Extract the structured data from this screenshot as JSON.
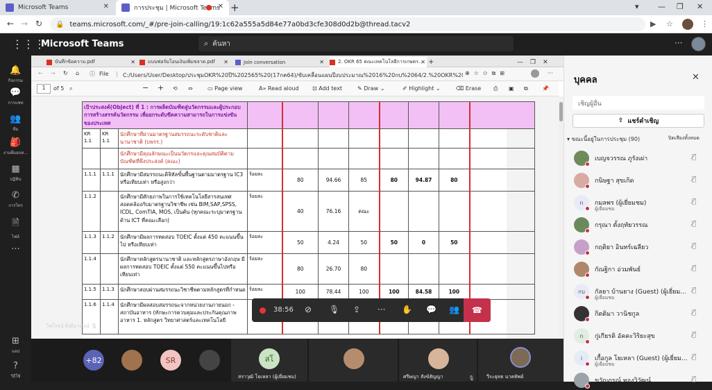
{
  "browser": {
    "tabs": [
      {
        "title": "Microsoft Teams",
        "active": false
      },
      {
        "title": "การประชุม | Microsoft Teams",
        "active": true
      }
    ],
    "url": "teams.microsoft.com/_#/pre-join-calling/19:1c62a555a5d84e77a0bd3cfe308d0d2b@thread.tacv2"
  },
  "teams": {
    "app_name": "Microsoft Teams",
    "search_placeholder": "ค้นหา",
    "rail": [
      "กิจกรรม",
      "การแชท",
      "ทีม",
      "งานที่มอบห...",
      "ปฏิทิน",
      "การโทร",
      "ไฟล์",
      "",
      "แอป",
      "วิธีใช้"
    ]
  },
  "shared": {
    "edge_tabs": [
      "บันทึกข้อความ.pdf",
      "แบบฟอร์มโอนเงินเพิ่มขจาด.pdf",
      "Join conversation",
      "2. OKR 65 คณะเทคโนโลยีการเกษตร..."
    ],
    "file_label": "File",
    "file_path": "C:/Users/User/Desktop/ประชุมOKR%20ปี%202565%20(17กค64)/ขับเคลื่อนแผนปีงบประมาณ%2016%20กบ%2064/2.%20OKR%2065%20คณะเทคโ...",
    "pdf": {
      "page": "1",
      "of_pages": "of 5",
      "page_view": "Page view",
      "read_aloud": "Read aloud",
      "add_text": "Add text",
      "draw": "Draw",
      "highlight": "Highlight",
      "erase": "Erase"
    },
    "table": {
      "objective": "เป้าประสงค์(Object) ที่ 1 : การผลิตบัณฑิตสู่นวัตกรรมและผู้ประกอบการสร้างสรรค์นวัตกรรม เพื่อยกระดับขีดความสามารถในการแข่งขันของประเทศ",
      "rows": [
        {
          "c1": "KR 1.1",
          "c2": "KR 1.1",
          "text": "นักศึกษาที่ผ่านมาตรฐานสมรรถนะระดับชาติและนานาชาติ (บพรร.)",
          "unit": "",
          "v": [
            "",
            "",
            "",
            "",
            "",
            ""
          ],
          "red": true
        },
        {
          "c1": "",
          "c2": "",
          "text": "นักศึกษามีคุณลักษณะเป็นนวัตกรและคุณสมบัติตามบัณฑิตที่พึงประสงค์ (คณะ)",
          "unit": "",
          "v": [
            "",
            "",
            "",
            "",
            "",
            ""
          ],
          "red": true
        },
        {
          "c1": "1.1.1",
          "c2": "1.1.1",
          "text": "นักศึกษามีสมรรถนะดิจิทัลขั้นพื้นฐานตามมาตรฐาน IC3 หรือเทียบเท่า หรือสูงกว่า",
          "unit": "ร้อยละ",
          "v": [
            "80",
            "94.66",
            "85",
            "80",
            "94.87",
            "80"
          ]
        },
        {
          "c1": "1.1.2",
          "c2": "",
          "text": "นักศึกษามีศักยภาพในการใช้เทคโนโลยีสารสนเทศสอดคล้องกับมาตรฐานวิชาชีพ เช่น BIM,SAP,SPSS, ICDL, ComTIA, MOS, เป็นต้น (ทุกคณะระบุมาตรฐานด้าน ICT ที่คณะเลือก)",
          "unit": "ร้อยละ",
          "v": [
            "40",
            "76.16",
            "คณะ",
            "",
            "",
            ""
          ]
        },
        {
          "c1": "1.1.3",
          "c2": "1.1.2",
          "text": "นักศึกษามีผลการทดสอบ TOEIC ตั้งแต่ 450 คะแนนขึ้นไป หรือเทียบเท่า",
          "unit": "ร้อยละ",
          "v": [
            "50",
            "4.24",
            "50",
            "50",
            "0",
            "50"
          ]
        },
        {
          "c1": "1.1.4",
          "c2": "",
          "text": "นักศึกษาหลักสูตรนานาชาติ และหลักสูตรภาษาอังกฤษ มีผลการทดสอบ TOEIC ตั้งแต่ 550 คะแนนขึ้นไปหรือเทียบเท่า",
          "unit": "ร้อยละ",
          "v": [
            "80",
            "26.70",
            "80",
            "",
            "",
            ""
          ]
        },
        {
          "c1": "1.1.5",
          "c2": "1.1.3",
          "text": "นักศึกษาสอบผ่านสมรรถนะวิชาชีพตามหลักสูตรที่กำหนด",
          "unit": "ร้อยละ",
          "v": [
            "100",
            "78.44",
            "100",
            "100",
            "84.58",
            "100"
          ]
        },
        {
          "c1": "1.1.6",
          "c2": "1.1.4",
          "text": "นักศึกษามีผลสอบสมรรถนะจากหน่วยงานภายนอก - สถาบันอาหาร (ทักษะการควบคุมและประกันคุณภาพอาหาร 1. หลักสูตร วิทยาศาสตร์และเทคโนโลยี",
          "unit": "",
          "v": [
            "",
            "",
            "",
            "",
            "",
            ""
          ]
        }
      ]
    }
  },
  "meeting": {
    "timer": "38:56",
    "presenter": "ไพโรจน์ ยิ่งมีอารมณ์"
  },
  "gallery": {
    "overflow": "+82",
    "tiles": [
      {
        "initials": "SR",
        "name": ""
      },
      {
        "initials": "สโ",
        "name": "สราวุฒิ โยเหลา (ผู้เยี่ยมชม)"
      },
      {
        "initials": "",
        "name": "ศรีษญา สังข์สัญญา"
      },
      {
        "initials": "",
        "name": "วีระยุทธ นาคทิพย์"
      }
    ]
  },
  "panel": {
    "title": "บุคคล",
    "invite_placeholder": "เชิญผู้อื่น",
    "share_invite": "แชร์คำเชิญ",
    "in_meeting": "ขณะนี้อยู่ในการประชุม (90)",
    "mute_all": "ปิดเสียงทั้งหมด",
    "people": [
      {
        "name": "เบญจวรรณ ภูรังเผ่า",
        "sub": "",
        "initials": ""
      },
      {
        "name": "กนิษฐา สุขเกิด",
        "sub": "",
        "initials": ""
      },
      {
        "name": "กมลพร (ผู้เยี่ยมชม)",
        "sub": "ผู้เยี่ยมชม",
        "initials": "n"
      },
      {
        "name": "กรุณา ตั้งฤทัยวรรณ",
        "sub": "",
        "initials": ""
      },
      {
        "name": "กฤติยา อินทร์เฉลียว",
        "sub": "",
        "initials": ""
      },
      {
        "name": "กัณฐิกา อ่วมพันธ์",
        "sub": "",
        "initials": ""
      },
      {
        "name": "กัลยา บ้านยาง (Guest) (ผู้เยี่ยม...",
        "sub": "ผู้เยี่ยมชม",
        "initials": "กบ"
      },
      {
        "name": "กิตติมา วานิชกูล",
        "sub": "",
        "initials": ""
      },
      {
        "name": "กู่เกียรติ อัคคะวิริยะสุข",
        "sub": "",
        "initials": "n"
      },
      {
        "name": "เกื้อกูล โยเหลา (Guest) (ผู้เยี่ยม...",
        "sub": "ผู้เยี่ยมชม",
        "initials": "i"
      },
      {
        "name": "ขวัญภรณ์ ทองวิวัฒน์",
        "sub": "",
        "initials": ""
      }
    ]
  },
  "colors": {
    "teams_purple": "#5b5fc7",
    "leave_red": "#c4314b",
    "objective_pink": "#f3c0f5",
    "rec_red": "#e8333b"
  }
}
